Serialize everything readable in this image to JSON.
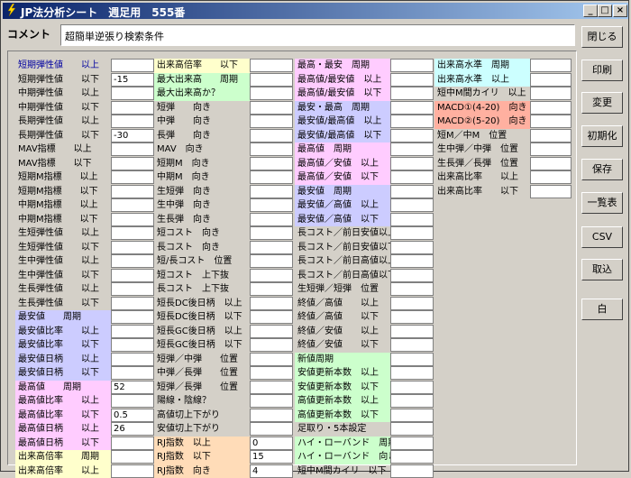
{
  "window": {
    "title": "JP法分析シート　週足用　555番",
    "minimize": "_",
    "maximize": "□",
    "close": "×"
  },
  "comment": {
    "label": "コメント",
    "value": "超簡単逆張り検索条件"
  },
  "side_buttons": [
    "閉じる",
    "印刷",
    "変更",
    "初期化",
    "保存",
    "一覧表",
    "CSV",
    "取込",
    "白"
  ],
  "colors": {
    "pink": "#ffccff",
    "lavender": "#ccccff",
    "yellow": "#ffffcc",
    "green": "#ccffcc",
    "peach": "#ffdcb8",
    "cyan": "#ccffff",
    "salmon": "#ffb0a0"
  },
  "columns": [
    {
      "rows": [
        {
          "label": "短期弾性値　　以上",
          "value": "",
          "bg": "",
          "blue": true
        },
        {
          "label": "短期弾性値　　以下",
          "value": "-15",
          "bg": ""
        },
        {
          "label": "中期弾性値　　以上",
          "value": "",
          "bg": ""
        },
        {
          "label": "中期弾性値　　以下",
          "value": "",
          "bg": ""
        },
        {
          "label": "長期弾性値　　以上",
          "value": "",
          "bg": ""
        },
        {
          "label": "長期弾性値　　以下",
          "value": "-30",
          "bg": ""
        },
        {
          "label": "MAV指標　　以上",
          "value": "",
          "bg": ""
        },
        {
          "label": "MAV指標　　以下",
          "value": "",
          "bg": ""
        },
        {
          "label": "短期M指標　　以上",
          "value": "",
          "bg": ""
        },
        {
          "label": "短期M指標　　以下",
          "value": "",
          "bg": ""
        },
        {
          "label": "中期M指標　　以上",
          "value": "",
          "bg": ""
        },
        {
          "label": "中期M指標　　以下",
          "value": "",
          "bg": ""
        },
        {
          "label": "生短弾性値　　以上",
          "value": "",
          "bg": ""
        },
        {
          "label": "生短弾性値　　以下",
          "value": "",
          "bg": ""
        },
        {
          "label": "生中弾性値　　以上",
          "value": "",
          "bg": ""
        },
        {
          "label": "生中弾性値　　以下",
          "value": "",
          "bg": ""
        },
        {
          "label": "生長弾性値　　以上",
          "value": "",
          "bg": ""
        },
        {
          "label": "生長弾性値　　以下",
          "value": "",
          "bg": ""
        },
        {
          "label": "最安値　　周期",
          "value": "",
          "bg": "lavender"
        },
        {
          "label": "最安値比率　　以上",
          "value": "",
          "bg": "lavender"
        },
        {
          "label": "最安値比率　　以下",
          "value": "",
          "bg": "lavender"
        },
        {
          "label": "最安値日柄　　以上",
          "value": "",
          "bg": "lavender"
        },
        {
          "label": "最安値日柄　　以下",
          "value": "",
          "bg": "lavender"
        },
        {
          "label": "最高値　　周期",
          "value": "52",
          "bg": "pink"
        },
        {
          "label": "最高値比率　　以上",
          "value": "",
          "bg": "pink"
        },
        {
          "label": "最高値比率　　以下",
          "value": "0.5",
          "bg": "pink"
        },
        {
          "label": "最高値日柄　　以上",
          "value": "26",
          "bg": "pink"
        },
        {
          "label": "最高値日柄　　以下",
          "value": "",
          "bg": "pink"
        },
        {
          "label": "出来高倍率　　周期",
          "value": "",
          "bg": "yellow"
        },
        {
          "label": "出来高倍率　　以上",
          "value": "",
          "bg": "yellow"
        }
      ]
    },
    {
      "rows": [
        {
          "label": "出来高倍率　　以下",
          "value": "",
          "bg": "yellow"
        },
        {
          "label": "最大出来高　　周期",
          "value": "",
          "bg": "green"
        },
        {
          "label": "最大出来高か？",
          "value": "",
          "bg": "green"
        },
        {
          "label": "短弾　　向き",
          "value": "",
          "bg": ""
        },
        {
          "label": "中弾　　向き",
          "value": "",
          "bg": ""
        },
        {
          "label": "長弾　　向き",
          "value": "",
          "bg": ""
        },
        {
          "label": "MAV　向き",
          "value": "",
          "bg": ""
        },
        {
          "label": "短期M　向き",
          "value": "",
          "bg": ""
        },
        {
          "label": "中期M　向き",
          "value": "",
          "bg": ""
        },
        {
          "label": "生短弾　向き",
          "value": "",
          "bg": ""
        },
        {
          "label": "生中弾　向き",
          "value": "",
          "bg": ""
        },
        {
          "label": "生長弾　向き",
          "value": "",
          "bg": ""
        },
        {
          "label": "短コスト　向き",
          "value": "",
          "bg": ""
        },
        {
          "label": "長コスト　向き",
          "value": "",
          "bg": ""
        },
        {
          "label": "短/長コスト　位置",
          "value": "",
          "bg": ""
        },
        {
          "label": "短コスト　上下抜",
          "value": "",
          "bg": ""
        },
        {
          "label": "長コスト　上下抜",
          "value": "",
          "bg": ""
        },
        {
          "label": "短長DC後日柄　以上",
          "value": "",
          "bg": ""
        },
        {
          "label": "短長DC後日柄　以下",
          "value": "",
          "bg": ""
        },
        {
          "label": "短長GC後日柄　以上",
          "value": "",
          "bg": ""
        },
        {
          "label": "短長GC後日柄　以下",
          "value": "",
          "bg": ""
        },
        {
          "label": "短弾／中弾　　位置",
          "value": "",
          "bg": ""
        },
        {
          "label": "中弾／長弾　　位置",
          "value": "",
          "bg": ""
        },
        {
          "label": "短弾／長弾　　位置",
          "value": "",
          "bg": ""
        },
        {
          "label": "陽線・陰線？",
          "value": "",
          "bg": ""
        },
        {
          "label": "高値切上下がり",
          "value": "",
          "bg": ""
        },
        {
          "label": "安値切上下がり",
          "value": "",
          "bg": ""
        },
        {
          "label": "RJ指数　以上",
          "value": "0",
          "bg": "peach"
        },
        {
          "label": "RJ指数　以下",
          "value": "15",
          "bg": "peach"
        },
        {
          "label": "RJ指数　向き",
          "value": "4",
          "bg": "peach"
        }
      ]
    },
    {
      "rows": [
        {
          "label": "最高・最安　周期",
          "value": "",
          "bg": "pink"
        },
        {
          "label": "最高値/最安値　以上",
          "value": "",
          "bg": "pink"
        },
        {
          "label": "最高値/最安値　以下",
          "value": "",
          "bg": "pink"
        },
        {
          "label": "最安・最高　周期",
          "value": "",
          "bg": "lavender"
        },
        {
          "label": "最安値/最高値　以上",
          "value": "",
          "bg": "lavender"
        },
        {
          "label": "最安値/最高値　以下",
          "value": "",
          "bg": "lavender"
        },
        {
          "label": "最高値　周期",
          "value": "",
          "bg": "pink"
        },
        {
          "label": "最高値／安値　以上",
          "value": "",
          "bg": "pink"
        },
        {
          "label": "最高値／安値　以下",
          "value": "",
          "bg": "pink"
        },
        {
          "label": "最安値　周期",
          "value": "",
          "bg": "lavender"
        },
        {
          "label": "最安値／高値　以上",
          "value": "",
          "bg": "lavender"
        },
        {
          "label": "最安値／高値　以下",
          "value": "",
          "bg": "lavender"
        },
        {
          "label": "長コスト／前日安値以上",
          "value": "",
          "bg": ""
        },
        {
          "label": "長コスト／前日安値以下",
          "value": "",
          "bg": ""
        },
        {
          "label": "長コスト／前日高値以上",
          "value": "",
          "bg": ""
        },
        {
          "label": "長コスト／前日高値以下",
          "value": "",
          "bg": ""
        },
        {
          "label": "生短弾／短弾　位置",
          "value": "",
          "bg": ""
        },
        {
          "label": "終値／高値　　以上",
          "value": "",
          "bg": ""
        },
        {
          "label": "終値／高値　　以下",
          "value": "",
          "bg": ""
        },
        {
          "label": "終値／安値　　以上",
          "value": "",
          "bg": ""
        },
        {
          "label": "終値／安値　　以下",
          "value": "",
          "bg": ""
        },
        {
          "label": "新値周期",
          "value": "",
          "bg": "green"
        },
        {
          "label": "安値更新本数　以上",
          "value": "",
          "bg": "green"
        },
        {
          "label": "安値更新本数　以下",
          "value": "",
          "bg": "green"
        },
        {
          "label": "高値更新本数　以上",
          "value": "",
          "bg": "green"
        },
        {
          "label": "高値更新本数　以下",
          "value": "",
          "bg": "green"
        },
        {
          "label": "足取り・5本設定",
          "value": "",
          "bg": ""
        },
        {
          "label": "ハイ・ローバンド　周期",
          "value": "",
          "bg": "green"
        },
        {
          "label": "ハイ・ローバンド　向き",
          "value": "",
          "bg": "green"
        },
        {
          "label": "短中M間カイリ　以下",
          "value": "",
          "bg": ""
        }
      ]
    },
    {
      "rows": [
        {
          "label": "出来高水準　周期",
          "value": "",
          "bg": "cyan"
        },
        {
          "label": "出来高水準　以上",
          "value": "",
          "bg": "cyan"
        },
        {
          "label": "短中M間カイリ　以上",
          "value": "",
          "bg": ""
        },
        {
          "label": "MACD①(4-20)　向き",
          "value": "",
          "bg": "salmon"
        },
        {
          "label": "MACD②(5-20)　向き",
          "value": "",
          "bg": "salmon"
        },
        {
          "label": "短M／中M　位置",
          "value": "",
          "bg": ""
        },
        {
          "label": "生中弾／中弾　位置",
          "value": "",
          "bg": ""
        },
        {
          "label": "生長弾／長弾　位置",
          "value": "",
          "bg": ""
        },
        {
          "label": "出来高比率　　以上",
          "value": "",
          "bg": ""
        },
        {
          "label": "出来高比率　　以下",
          "value": "",
          "bg": ""
        }
      ]
    }
  ]
}
